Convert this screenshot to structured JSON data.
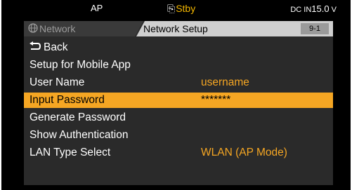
{
  "status": {
    "mode": "AP",
    "record_state": "Stby",
    "record_icon": "card-icon",
    "power_source": "DC IN",
    "voltage": "15.0",
    "voltage_unit": "V"
  },
  "header": {
    "parent_tab": "Network",
    "parent_icon": "globe-icon",
    "title": "Network Setup",
    "page": "9-1"
  },
  "menu": {
    "items": [
      {
        "label": "Back",
        "value": "",
        "icon": "back-arrow-icon"
      },
      {
        "label": "Setup for Mobile App",
        "value": ""
      },
      {
        "label": "User Name",
        "value": "username"
      },
      {
        "label": "Input Password",
        "value": "*******"
      },
      {
        "label": "Generate Password",
        "value": ""
      },
      {
        "label": "Show Authentication",
        "value": ""
      },
      {
        "label": "LAN Type Select",
        "value": "WLAN (AP Mode)"
      }
    ],
    "selected_index": 3
  },
  "colors": {
    "accent": "#f5a623",
    "tally": "#f5b800"
  }
}
